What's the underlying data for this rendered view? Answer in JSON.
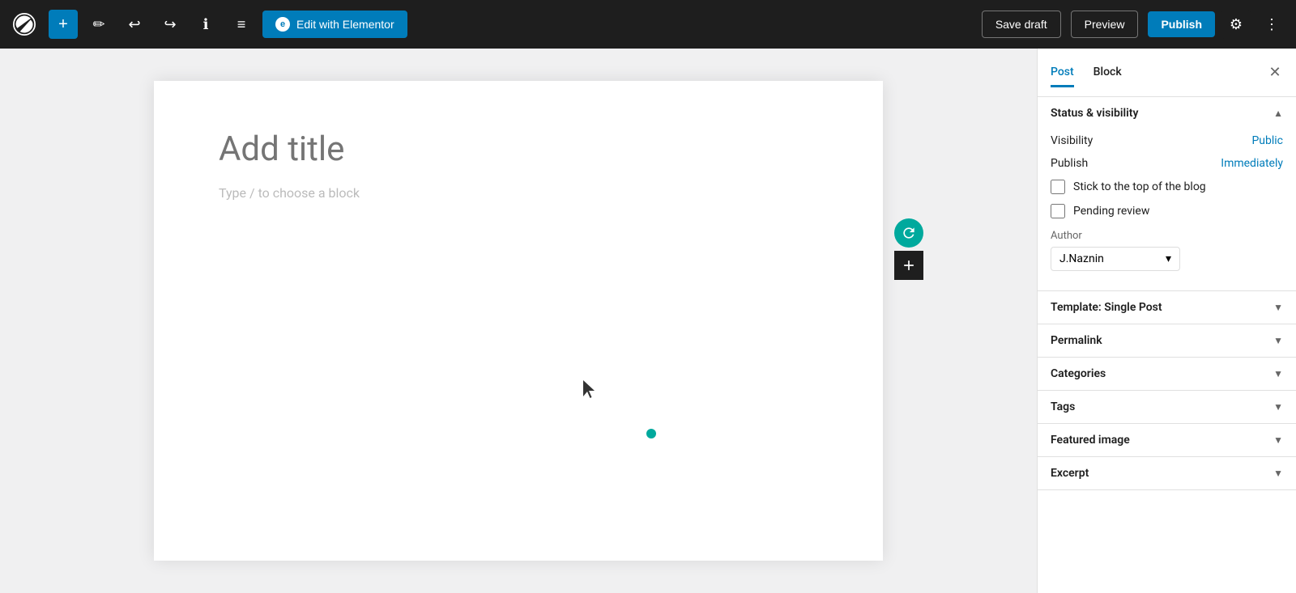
{
  "toolbar": {
    "add_label": "+",
    "edit_elementor_label": "Edit with Elementor",
    "elementor_icon": "e",
    "save_draft_label": "Save draft",
    "preview_label": "Preview",
    "publish_label": "Publish",
    "undo_icon": "↩",
    "redo_icon": "↪",
    "info_icon": "ℹ",
    "menu_icon": "≡",
    "settings_icon": "⚙",
    "more_icon": "⋮"
  },
  "editor": {
    "title_placeholder": "Add title",
    "block_placeholder": "Type / to choose a block"
  },
  "sidebar": {
    "post_tab": "Post",
    "block_tab": "Block",
    "close_icon": "✕",
    "sections": {
      "status_visibility": {
        "title": "Status & visibility",
        "expanded": true,
        "visibility_label": "Visibility",
        "visibility_value": "Public",
        "publish_label": "Publish",
        "publish_value": "Immediately",
        "stick_to_top_label": "Stick to the top of the blog",
        "stick_to_top_checked": false,
        "pending_review_label": "Pending review",
        "pending_review_checked": false,
        "author_label": "Author",
        "author_value": "J.Naznin"
      },
      "template": {
        "title": "Template: Single Post",
        "expanded": false
      },
      "permalink": {
        "title": "Permalink",
        "expanded": false
      },
      "categories": {
        "title": "Categories",
        "expanded": false
      },
      "tags": {
        "title": "Tags",
        "expanded": false
      },
      "featured_image": {
        "title": "Featured image",
        "expanded": false
      },
      "excerpt": {
        "title": "Excerpt",
        "expanded": false
      }
    }
  },
  "colors": {
    "accent": "#007cba",
    "dark": "#1e1e1e",
    "green": "#00a99d",
    "border": "#e0e0e0"
  }
}
